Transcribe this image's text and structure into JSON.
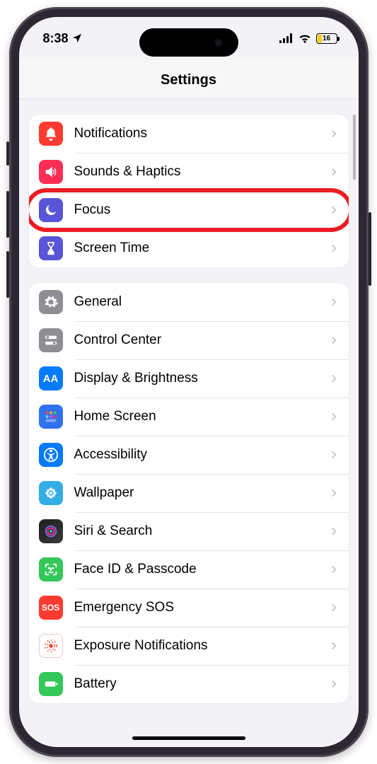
{
  "status": {
    "time": "8:38",
    "battery_pct": "16"
  },
  "title": "Settings",
  "groups": [
    {
      "items": [
        {
          "key": "notifications",
          "label": "Notifications",
          "icon": "bell-icon",
          "bg": "bg-red"
        },
        {
          "key": "sounds",
          "label": "Sounds & Haptics",
          "icon": "speaker-icon",
          "bg": "bg-pink"
        },
        {
          "key": "focus",
          "label": "Focus",
          "icon": "moon-icon",
          "bg": "bg-indigo",
          "highlight": true
        },
        {
          "key": "screen-time",
          "label": "Screen Time",
          "icon": "hourglass-icon",
          "bg": "bg-indigo"
        }
      ]
    },
    {
      "items": [
        {
          "key": "general",
          "label": "General",
          "icon": "gear-icon",
          "bg": "bg-gray"
        },
        {
          "key": "control-center",
          "label": "Control Center",
          "icon": "toggles-icon",
          "bg": "bg-gray"
        },
        {
          "key": "display",
          "label": "Display & Brightness",
          "icon": "aa-icon",
          "bg": "bg-blue"
        },
        {
          "key": "home",
          "label": "Home Screen",
          "icon": "grid-icon",
          "bg": "bg-blue2"
        },
        {
          "key": "accessibility",
          "label": "Accessibility",
          "icon": "accessibility-icon",
          "bg": "bg-blue"
        },
        {
          "key": "wallpaper",
          "label": "Wallpaper",
          "icon": "flower-icon",
          "bg": "bg-cyan"
        },
        {
          "key": "siri",
          "label": "Siri & Search",
          "icon": "siri-icon",
          "bg": "bg-siri"
        },
        {
          "key": "faceid",
          "label": "Face ID & Passcode",
          "icon": "faceid-icon",
          "bg": "bg-green"
        },
        {
          "key": "sos",
          "label": "Emergency SOS",
          "icon": "sos-icon",
          "bg": "bg-sosred"
        },
        {
          "key": "exposure",
          "label": "Exposure Notifications",
          "icon": "exposure-icon",
          "bg": "bg-white-red"
        },
        {
          "key": "battery",
          "label": "Battery",
          "icon": "battery-icon",
          "bg": "bg-green"
        }
      ]
    }
  ]
}
